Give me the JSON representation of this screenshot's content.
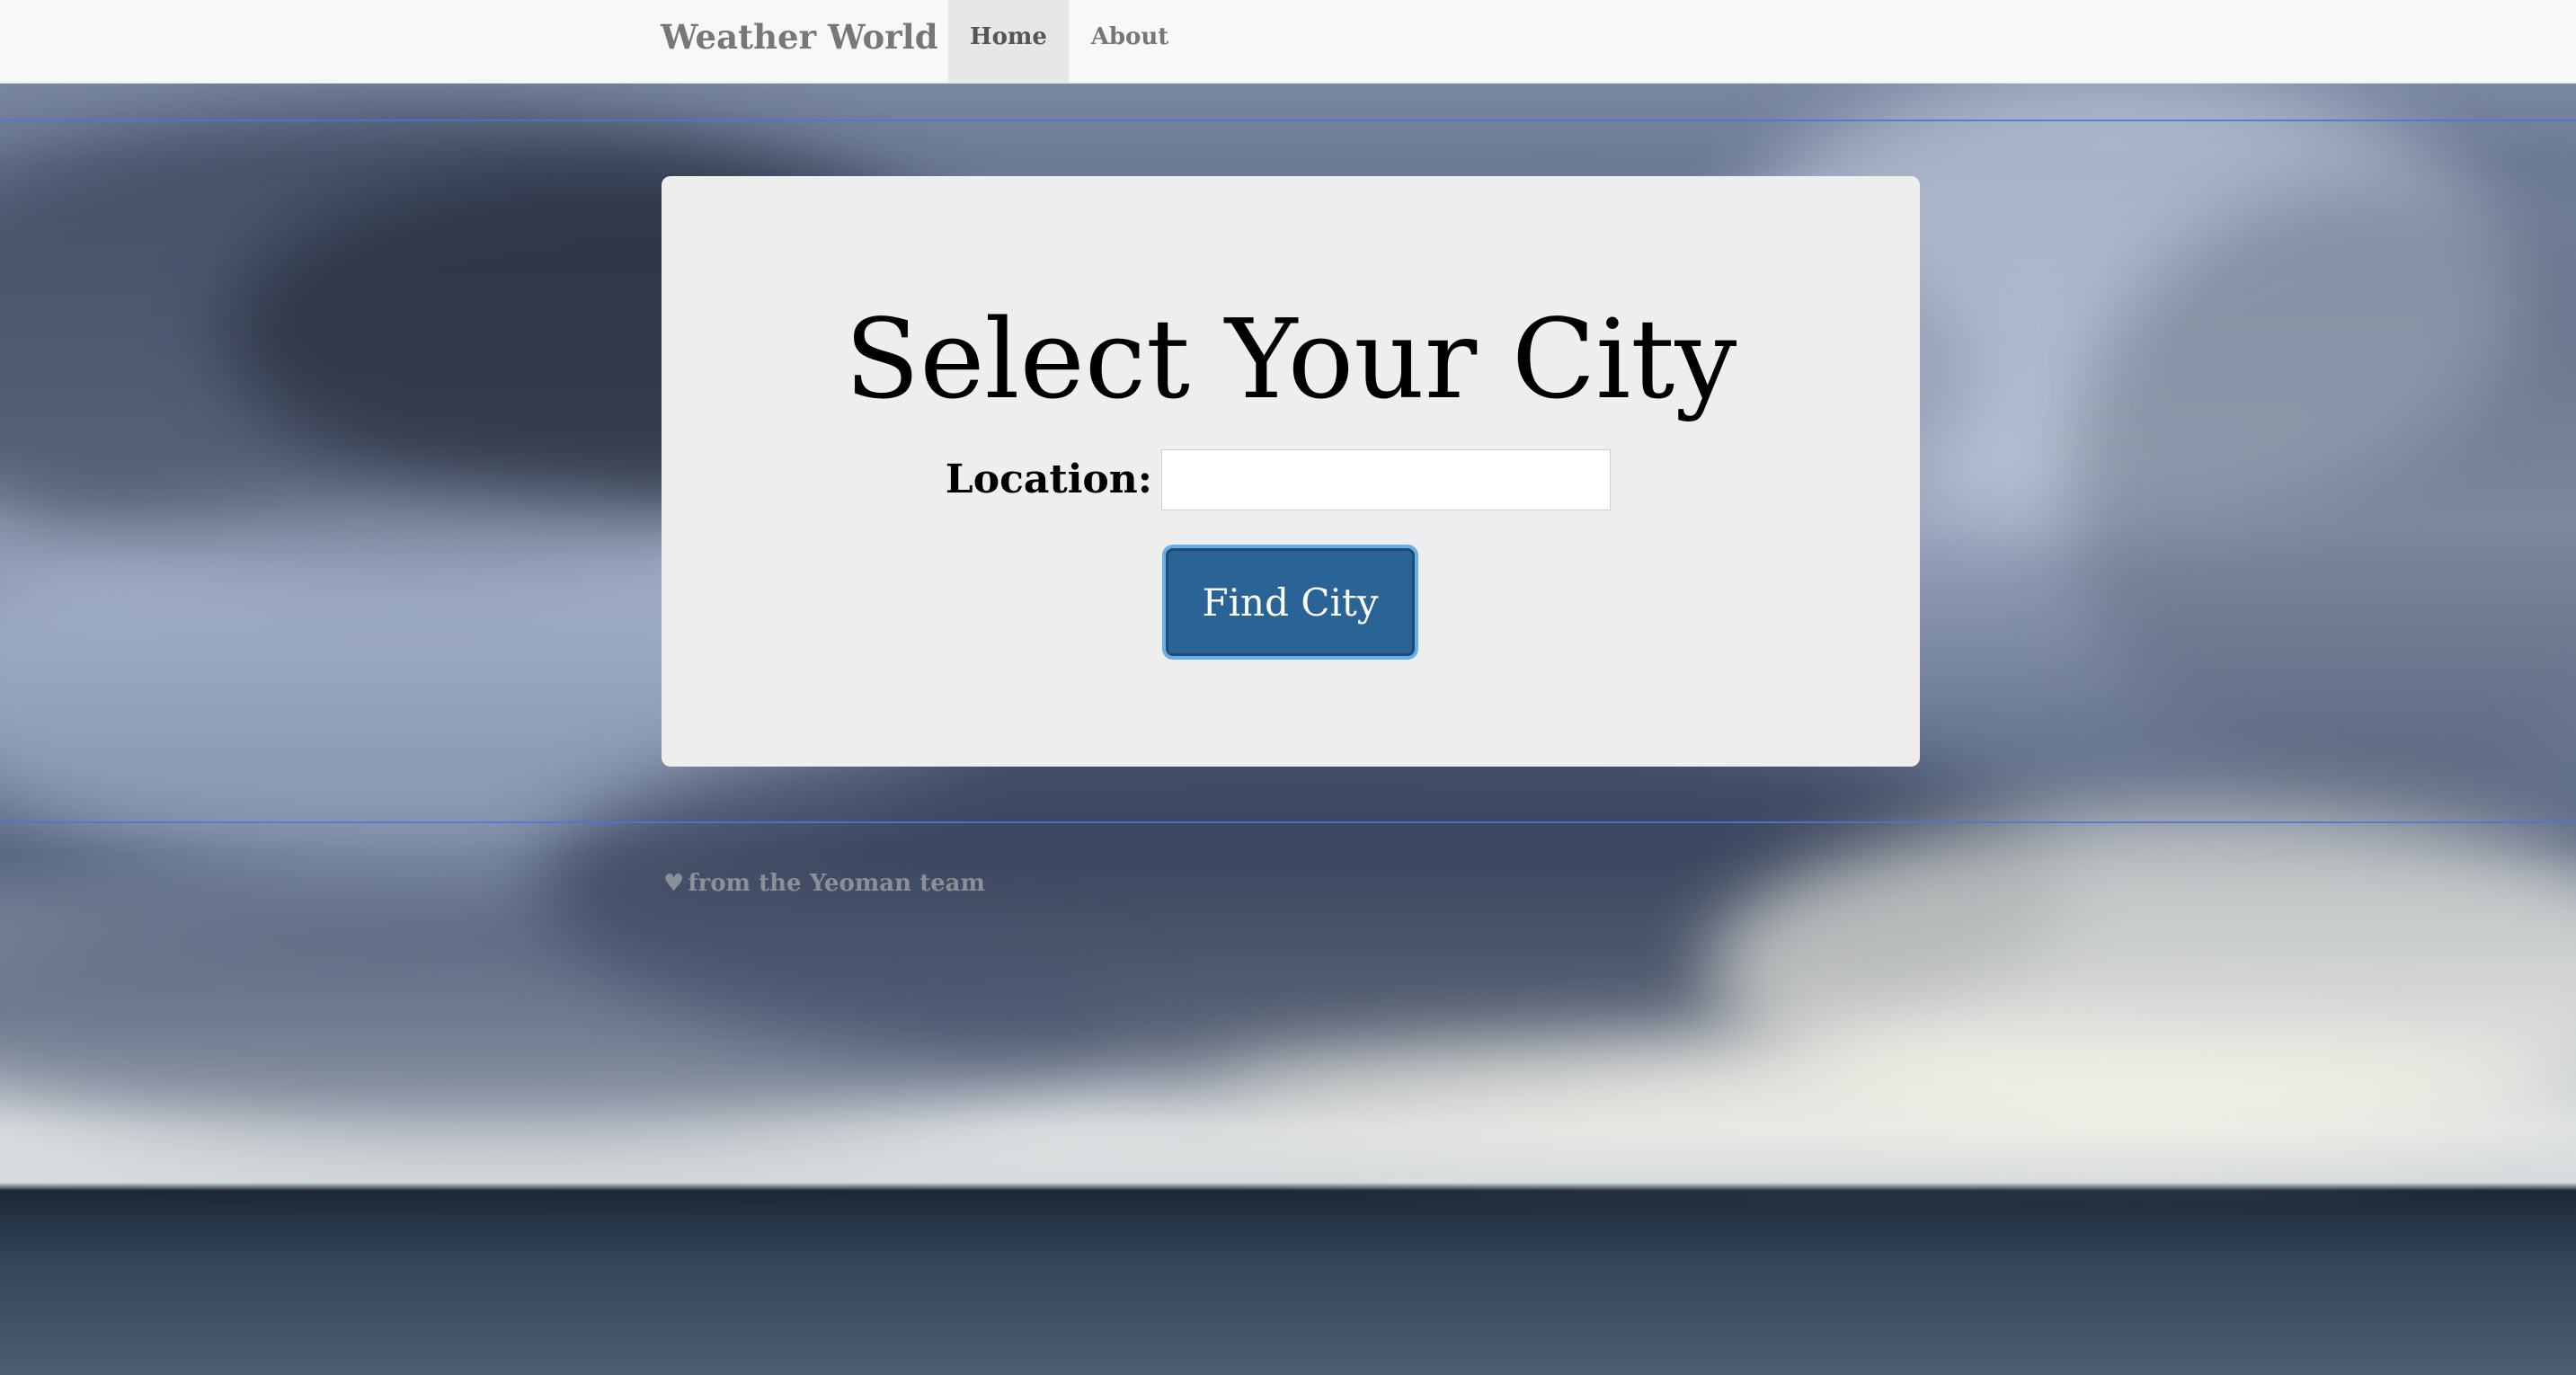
{
  "navbar": {
    "brand": "Weather World",
    "items": [
      {
        "label": "Home",
        "active": true
      },
      {
        "label": "About",
        "active": false
      }
    ]
  },
  "main": {
    "title": "Select Your City",
    "location_label": "Location:",
    "location_value": "",
    "location_placeholder": "",
    "find_button": "Find City"
  },
  "footer": {
    "icon": "heart-icon",
    "text": "from the Yeoman team"
  },
  "colors": {
    "navbar_bg": "#f8f8f8",
    "panel_bg": "#eeeeee",
    "button_bg": "#2a6496",
    "button_focus_ring": "#66afe9",
    "guide_line": "#4f73d9"
  }
}
